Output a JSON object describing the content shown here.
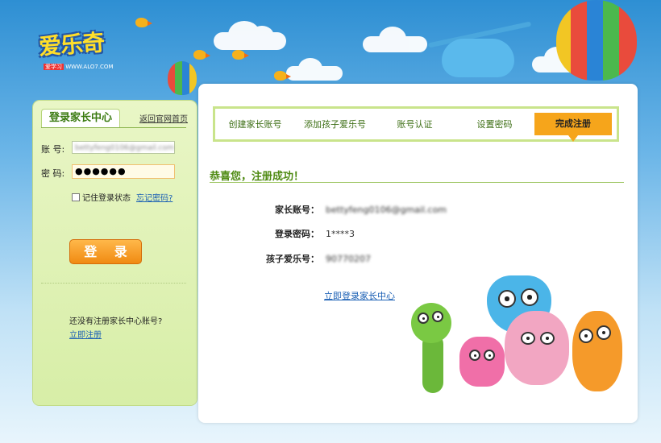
{
  "brand": {
    "logo_text": "爱乐奇",
    "logo_badge": "爱学习",
    "logo_url": "WWW.ALO7.COM"
  },
  "login": {
    "tab_title": "登录家长中心",
    "home_link": "返回官网首页",
    "account_label": "账 号:",
    "account_value": "bettyfeng0106@gmail.com",
    "password_label": "密 码:",
    "password_value": "●●●●●●",
    "remember_label": "记住登录状态",
    "forgot_link": "忘记密码?",
    "login_button": "登 录",
    "no_account_text": "还没有注册家长中心账号?",
    "register_link": "立即注册"
  },
  "steps": [
    {
      "label": "创建家长账号"
    },
    {
      "label": "添加孩子爱乐号"
    },
    {
      "label": "账号认证"
    },
    {
      "label": "设置密码"
    },
    {
      "label": "完成注册"
    }
  ],
  "result": {
    "heading": "恭喜您，注册成功！",
    "rows": [
      {
        "label": "家长账号：",
        "value": "bettyfeng0106@gmail.com"
      },
      {
        "label": "登录密码：",
        "value": "1****3"
      },
      {
        "label": "孩子爱乐号：",
        "value": "90770207"
      }
    ],
    "enter_link": "立即登录家长中心"
  },
  "colors": {
    "accent_green": "#4e8a12",
    "step_active": "#f6a51b",
    "link_blue": "#1a5fb4",
    "login_button": "#f08a12"
  }
}
